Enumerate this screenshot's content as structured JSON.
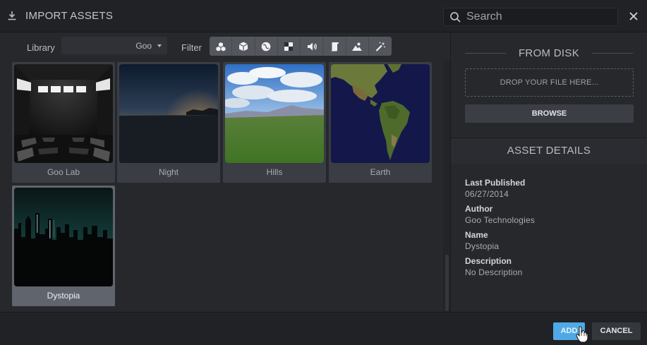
{
  "header": {
    "title": "IMPORT ASSETS",
    "icon": "download-icon",
    "search_placeholder": "Search",
    "close_icon": "close-icon"
  },
  "toolbar": {
    "library_label": "Library",
    "library_value": "Goo",
    "filter_label": "Filter",
    "filters": [
      {
        "name": "all-assets-icon"
      },
      {
        "name": "cube-icon"
      },
      {
        "name": "sphere-icon"
      },
      {
        "name": "texture-icon"
      },
      {
        "name": "sound-icon"
      },
      {
        "name": "script-icon"
      },
      {
        "name": "skybox-icon"
      },
      {
        "name": "effects-wand-icon"
      }
    ]
  },
  "assets": [
    {
      "label": "Goo Lab",
      "selected": false
    },
    {
      "label": "Night",
      "selected": false
    },
    {
      "label": "Hills",
      "selected": false
    },
    {
      "label": "Earth",
      "selected": false
    },
    {
      "label": "Dystopia",
      "selected": true
    }
  ],
  "right_panel": {
    "from_disk_title": "FROM DISK",
    "dropzone_text": "DROP YOUR FILE HERE...",
    "browse_label": "BROWSE",
    "asset_details_title": "ASSET DETAILS",
    "details": [
      {
        "key": "Last Published",
        "value": "06/27/2014"
      },
      {
        "key": "Author",
        "value": "Goo Technologies"
      },
      {
        "key": "Name",
        "value": "Dystopia"
      },
      {
        "key": "Description",
        "value": "No Description"
      }
    ]
  },
  "footer": {
    "add_label": "ADD",
    "cancel_label": "CANCEL"
  },
  "colors": {
    "accent": "#4fa9e6",
    "background": "#26282c",
    "header": "#202226"
  }
}
